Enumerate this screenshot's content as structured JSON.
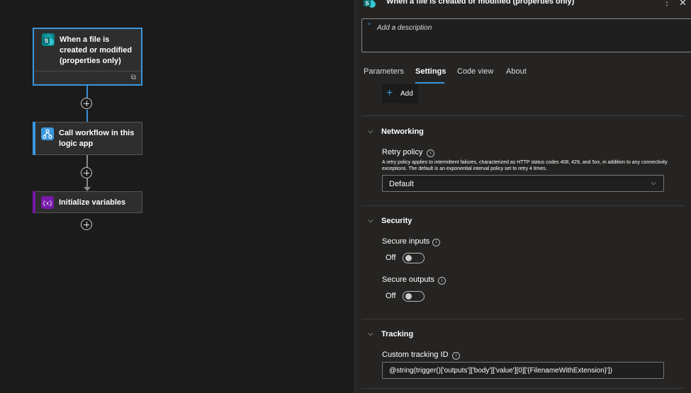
{
  "canvas": {
    "nodes": [
      {
        "title": "When a file is created or modified (properties only)",
        "icon": "sharepoint-icon",
        "color": "#038387"
      },
      {
        "title": "Call workflow in this logic app",
        "icon": "workflow-icon",
        "color": "#3a96dd"
      },
      {
        "title": "Initialize variables",
        "icon": "variables-icon",
        "color": "#7719aa"
      }
    ]
  },
  "panel": {
    "title": "When a file is created or modified (properties only)",
    "description_placeholder": "Add a description",
    "tabs": [
      "Parameters",
      "Settings",
      "Code view",
      "About"
    ],
    "active_tab": "Settings",
    "add_label": "Add",
    "networking": {
      "title": "Networking",
      "retry_label": "Retry policy",
      "retry_help": "A retry policy applies to intermittent failures, characterized as HTTP status codes 408, 429, and 5xx, in addition to any connectivity exceptions. The default is an exponential interval policy set to retry 4 times.",
      "retry_value": "Default"
    },
    "security": {
      "title": "Security",
      "secure_inputs_label": "Secure inputs",
      "secure_inputs_state": "Off",
      "secure_outputs_label": "Secure outputs",
      "secure_outputs_state": "Off"
    },
    "tracking": {
      "title": "Tracking",
      "custom_id_label": "Custom tracking ID",
      "custom_id_value": "@string(trigger()['outputs']['body']['value'][0]['{FilenameWithExtension}'])"
    }
  },
  "colors": {
    "accent": "#3a96dd",
    "background": "#1b1b1b",
    "panel": "#252423"
  }
}
